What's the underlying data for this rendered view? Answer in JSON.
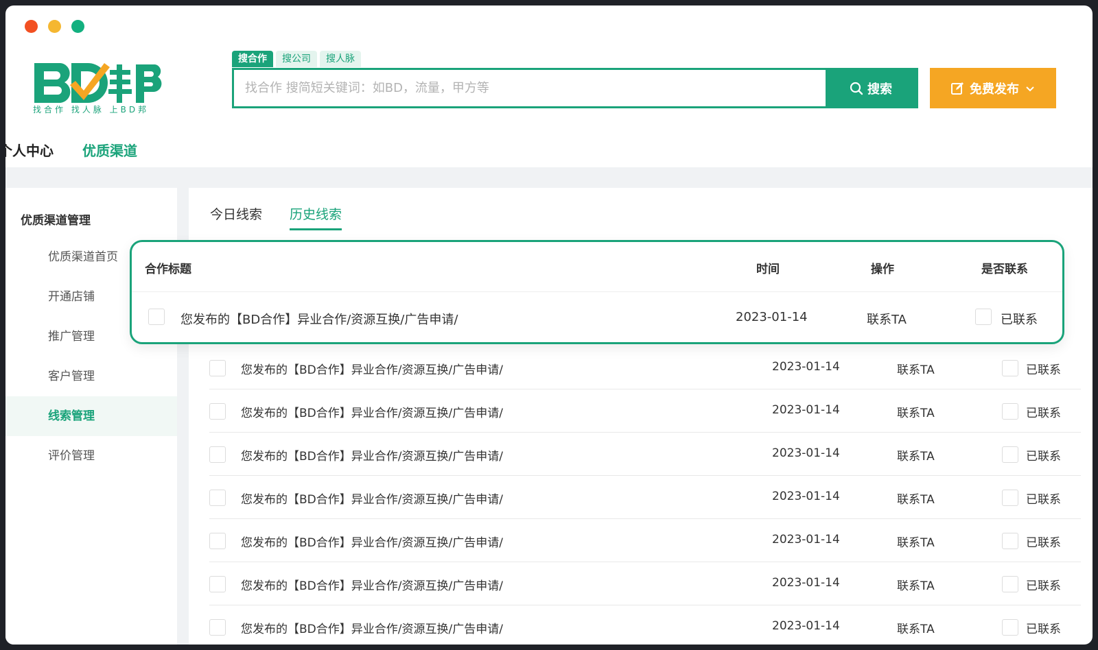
{
  "logo": {
    "text": "BD邦",
    "slogan": "找合作 找人脉 上BD邦"
  },
  "search": {
    "tabs": [
      "搜合作",
      "搜公司",
      "搜人脉"
    ],
    "placeholder": "找合作 搜简短关键词：如BD，流量，甲方等",
    "button_label": "搜索"
  },
  "publish_button_label": "免费发布",
  "nav": {
    "items": [
      "个人中心",
      "优质渠道"
    ]
  },
  "sidebar": {
    "title": "优质渠道管理",
    "items": [
      "优质渠道首页",
      "开通店铺",
      "推广管理",
      "客户管理",
      "线索管理",
      "评价管理"
    ],
    "active": "线索管理"
  },
  "content_tabs": [
    "今日线索",
    "历史线索"
  ],
  "table": {
    "headers": {
      "title": "合作标题",
      "time": "时间",
      "action": "操作",
      "contacted": "是否联系"
    },
    "rows": [
      {
        "title": "您发布的【BD合作】异业合作/资源互换/广告申请/",
        "date": "2023-01-14",
        "action": "联系TA",
        "contacted": "已联系"
      },
      {
        "title": "您发布的【BD合作】异业合作/资源互换/广告申请/",
        "date": "2023-01-14",
        "action": "联系TA",
        "contacted": "已联系"
      },
      {
        "title": "您发布的【BD合作】异业合作/资源互换/广告申请/",
        "date": "2023-01-14",
        "action": "联系TA",
        "contacted": "已联系"
      },
      {
        "title": "您发布的【BD合作】异业合作/资源互换/广告申请/",
        "date": "2023-01-14",
        "action": "联系TA",
        "contacted": "已联系"
      },
      {
        "title": "您发布的【BD合作】异业合作/资源互换/广告申请/",
        "date": "2023-01-14",
        "action": "联系TA",
        "contacted": "已联系"
      },
      {
        "title": "您发布的【BD合作】异业合作/资源互换/广告申请/",
        "date": "2023-01-14",
        "action": "联系TA",
        "contacted": "已联系"
      },
      {
        "title": "您发布的【BD合作】异业合作/资源互换/广告申请/",
        "date": "2023-01-14",
        "action": "联系TA",
        "contacted": "已联系"
      },
      {
        "title": "您发布的【BD合作】异业合作/资源互换/广告申请/",
        "date": "2023-01-14",
        "action": "联系TA",
        "contacted": "已联系"
      }
    ]
  },
  "colors": {
    "brand_green": "#1aa37a",
    "publish_orange": "#f5a623",
    "dot_red": "#f25022",
    "dot_yellow": "#f5b731",
    "dot_green": "#12b07f"
  }
}
